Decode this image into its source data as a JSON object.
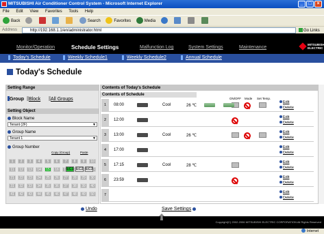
{
  "window": {
    "title": "MITSUBISHI Air Conditioner Control System - Microsoft Internet Explorer"
  },
  "menu": [
    "File",
    "Edit",
    "View",
    "Favorites",
    "Tools",
    "Help"
  ],
  "toolbar": {
    "back": "Back",
    "search": "Search",
    "favorites": "Favorites",
    "media": "Media"
  },
  "address": {
    "label": "Address",
    "url": "http://192.168.1.1/en/administrator.html",
    "go": "Go",
    "links": "Links"
  },
  "nav": {
    "tabs": [
      "Monitor/Operation",
      "Schedule Settings",
      "Malfunction Log",
      "System Settings",
      "Maintenance"
    ],
    "selected": "Schedule Settings"
  },
  "logo": {
    "text": "MITSUBISHI ELECTRIC"
  },
  "subnav": [
    "Today's Schedule",
    "Weekly Schedule1",
    "Weekly Schedule2",
    "Annual Schedule"
  ],
  "page": {
    "title": "Today's Schedule"
  },
  "left": {
    "setting_range_head": "Setting Range",
    "range_opts": [
      "Group",
      "Block",
      "All Groups"
    ],
    "setting_object_head": "Setting Object",
    "block_label": "Block Name",
    "block_value": "Tenant (2F)",
    "group_label": "Group Name",
    "group_value": "Tenant 1",
    "group_number_label": "Group Number",
    "ec_buttons": [
      "EC1",
      "EC2",
      "EC3"
    ],
    "copy": "Copy (Group)",
    "paste": "Paste",
    "numbers": [
      "1",
      "2",
      "3",
      "4",
      "5",
      "6",
      "7",
      "8",
      "9",
      "10",
      "11",
      "12",
      "13",
      "14",
      "15",
      "16",
      "17",
      "18",
      "19",
      "20",
      "21",
      "22",
      "23",
      "24",
      "25",
      "26",
      "27",
      "28",
      "29",
      "30",
      "31",
      "32",
      "33",
      "34",
      "35",
      "36",
      "37",
      "38",
      "39",
      "40",
      "41",
      "42",
      "43",
      "44",
      "45",
      "46",
      "47",
      "48",
      "49",
      "50"
    ],
    "selected_number": "15"
  },
  "right": {
    "head": "Contents of Today's Schedule",
    "subhead": "Contents of Schedule",
    "cols": [
      "ON/OFF",
      "Mode",
      "Set Temp."
    ],
    "edit": "Edit",
    "delete": "Delete",
    "rows": [
      {
        "n": "1",
        "time": "08:00",
        "mode": "Cool",
        "temp": "26 ℃"
      },
      {
        "n": "2",
        "time": "12:00",
        "mode": "",
        "temp": ""
      },
      {
        "n": "3",
        "time": "13:00",
        "mode": "Cool",
        "temp": "26 ℃"
      },
      {
        "n": "4",
        "time": "17:00",
        "mode": "",
        "temp": ""
      },
      {
        "n": "5",
        "time": "17:15",
        "mode": "Cool",
        "temp": "28 ℃"
      },
      {
        "n": "6",
        "time": "23:59",
        "mode": "",
        "temp": ""
      },
      {
        "n": "7",
        "time": "",
        "mode": "",
        "temp": ""
      }
    ]
  },
  "bottom": {
    "undo": "Undo",
    "save": "Save Settings"
  },
  "footer": {
    "copyright": "Copyright(C) 2002-2006 MITSUBISHI ELECTRIC CORPORATION All Rights Reserved"
  },
  "status": {
    "zone": "Internet"
  }
}
